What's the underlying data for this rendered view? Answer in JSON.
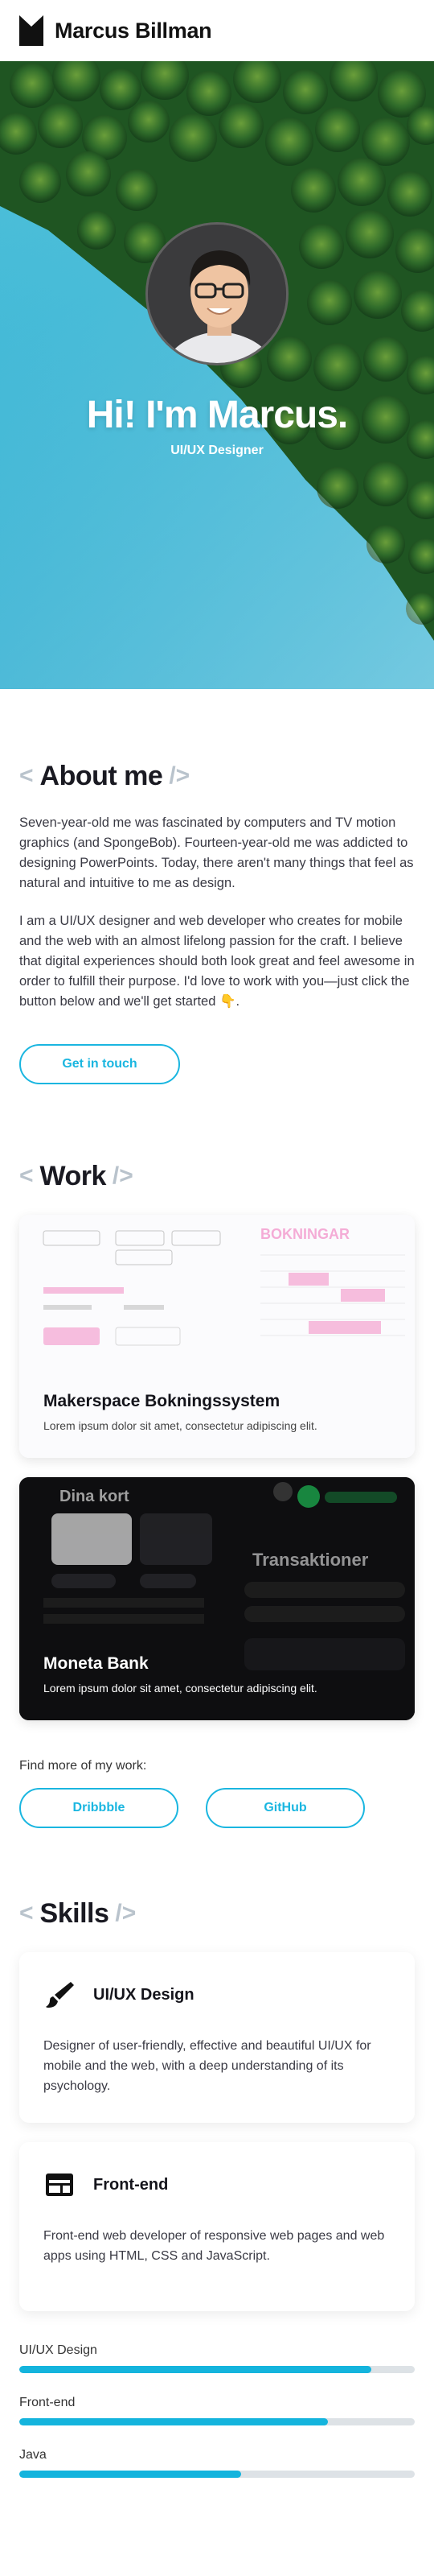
{
  "header": {
    "site_name": "Marcus Billman"
  },
  "hero": {
    "title": "Hi! I'm Marcus.",
    "subtitle": "UI/UX Designer"
  },
  "about": {
    "heading": "About me",
    "paragraphs": [
      "Seven-year-old me was fascinated by computers and TV motion graphics (and SpongeBob). Fourteen-year-old me was addicted to designing PowerPoints. Today, there aren't many things that feel as natural and intuitive to me as design.",
      "I am a UI/UX designer and web developer who creates for mobile and the web with an almost lifelong passion for the craft. I believe that digital experiences should both look great and feel awesome in order to fulfill their purpose. I'd love to work with you—just click the button below and we'll get started 👇."
    ],
    "cta": "Get in touch"
  },
  "work": {
    "heading": "Work",
    "projects": [
      {
        "title": "Makerspace Bokningssystem",
        "description": "Lorem ipsum dolor sit amet, consectetur adipiscing elit."
      },
      {
        "title": "Moneta Bank",
        "description": "Lorem ipsum dolor sit amet, consectetur adipiscing elit."
      }
    ],
    "more_label": "Find more of my work:",
    "links": [
      "Dribbble",
      "GitHub"
    ]
  },
  "skills": {
    "heading": "Skills",
    "cards": [
      {
        "title": "UI/UX Design",
        "icon": "brush-icon",
        "description": "Designer of user-friendly, effective and beautiful UI/UX for mobile and the web, with a deep understanding of its psychology."
      },
      {
        "title": "Front-end",
        "icon": "browser-window-icon",
        "description": "Front-end web developer of responsive web pages and web apps using HTML, CSS and JavaScript."
      }
    ],
    "levels": [
      {
        "label": "UI/UX Design",
        "percent": 89
      },
      {
        "label": "Front-end",
        "percent": 78
      },
      {
        "label": "Java",
        "percent": 56
      }
    ]
  },
  "colors": {
    "accent": "#14b4dd",
    "water": "#3fb8d6",
    "forest": "#2f6b2a"
  }
}
